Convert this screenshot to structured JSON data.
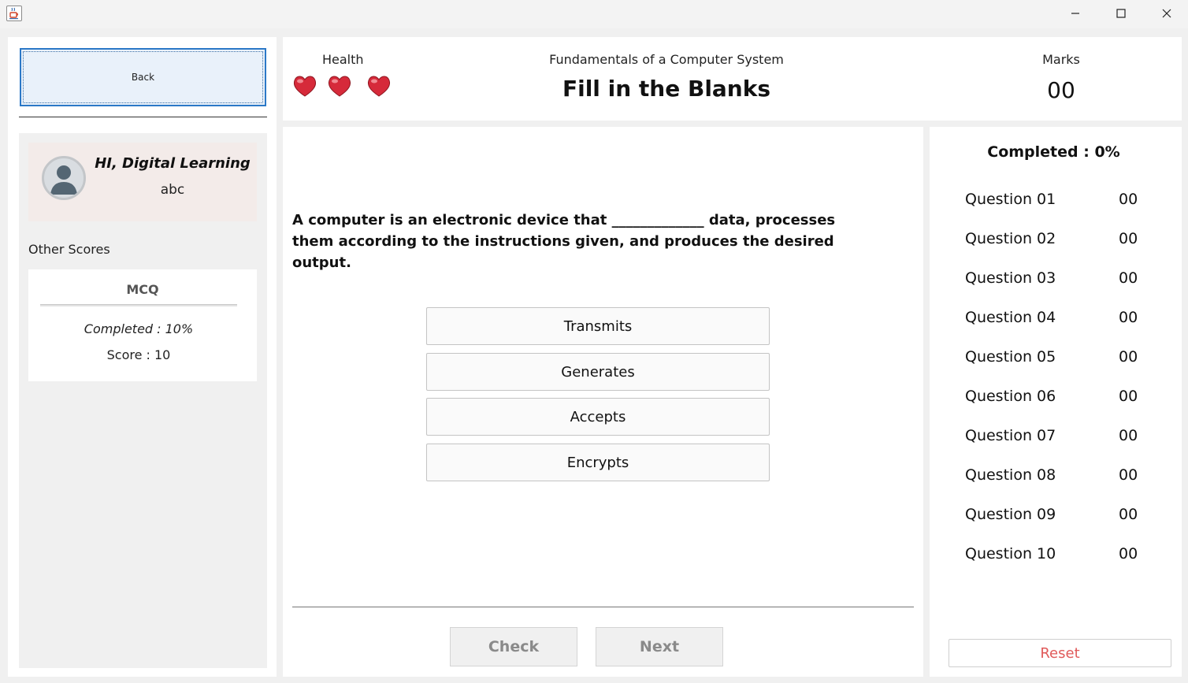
{
  "window": {
    "app_icon": "java-cup-icon",
    "controls": [
      "minimize-icon",
      "maximize-icon",
      "close-icon"
    ]
  },
  "sidebar": {
    "back_label": "Back",
    "profile": {
      "greeting": "HI, Digital Learning",
      "username": "abc",
      "avatar_icon": "user-avatar-icon"
    },
    "other_scores_label": "Other Scores",
    "score_card": {
      "title": "MCQ",
      "completed": "Completed : 10%",
      "score": "Score : 10"
    }
  },
  "header": {
    "health_label": "Health",
    "hearts": 3,
    "subject": "Fundamentals of a Computer System",
    "title": "Fill in the Blanks",
    "marks_label": "Marks",
    "marks_value": "00"
  },
  "question": {
    "text": "A computer is an electronic device that _____________ data, processes them according to the instructions given, and produces the desired output.",
    "options": [
      "Transmits",
      "Generates",
      "Accepts",
      "Encrypts"
    ]
  },
  "actions": {
    "check_label": "Check",
    "next_label": "Next"
  },
  "progress": {
    "completed_label": "Completed : 0%",
    "questions": [
      {
        "label": "Question 01",
        "score": "00"
      },
      {
        "label": "Question 02",
        "score": "00"
      },
      {
        "label": "Question 03",
        "score": "00"
      },
      {
        "label": "Question 04",
        "score": "00"
      },
      {
        "label": "Question 05",
        "score": "00"
      },
      {
        "label": "Question 06",
        "score": "00"
      },
      {
        "label": "Question 07",
        "score": "00"
      },
      {
        "label": "Question 08",
        "score": "00"
      },
      {
        "label": "Question 09",
        "score": "00"
      },
      {
        "label": "Question 10",
        "score": "00"
      }
    ],
    "reset_label": "Reset"
  },
  "colors": {
    "accent_focus": "#2b78c7",
    "reset_text": "#e05a5a",
    "heart": "#d62a3a",
    "profile_card_bg": "#f3ebe9"
  }
}
